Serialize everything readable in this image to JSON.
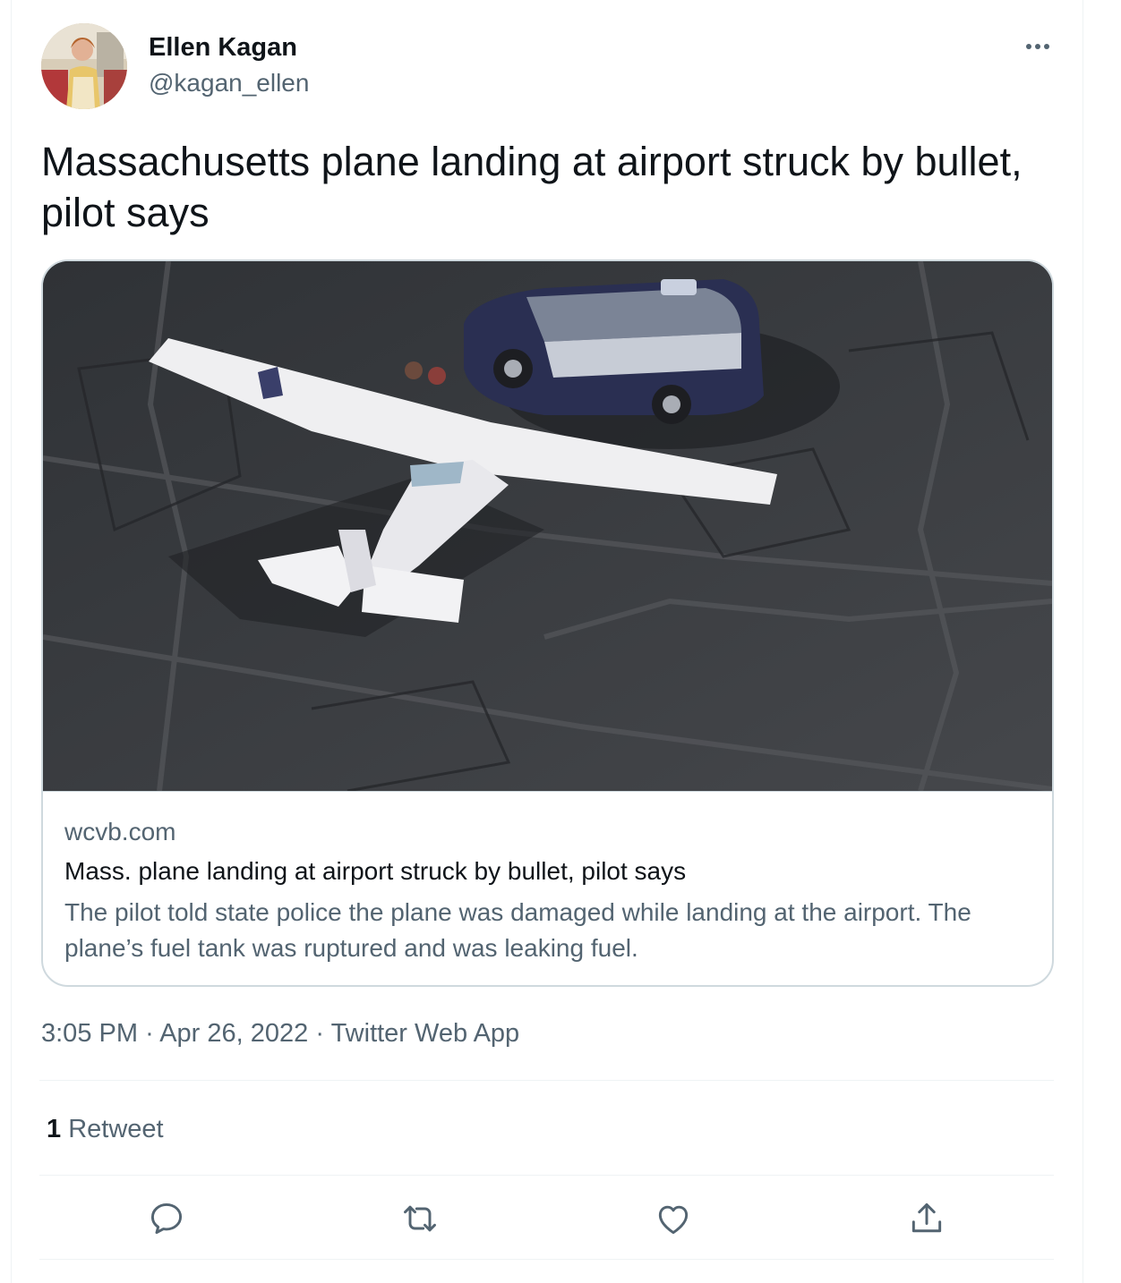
{
  "user": {
    "name": "Ellen Kagan",
    "handle": "@kagan_ellen"
  },
  "tweet": {
    "text": "Massachusetts plane landing at airport struck by bullet, pilot says"
  },
  "card": {
    "domain": "wcvb.com",
    "title": "Mass. plane landing at airport struck by bullet, pilot says",
    "description": "The pilot told state police the plane was damaged while landing at the airport. The plane’s fuel tank was ruptured and was leaking fuel."
  },
  "meta": {
    "time": "3:05 PM",
    "separator": "·",
    "date": "Apr 26, 2022",
    "source": "Twitter Web App"
  },
  "stats": {
    "retweet_count": "1",
    "retweet_label": "Retweet"
  },
  "actions": [
    {
      "icon": "reply-icon"
    },
    {
      "icon": "retweet-icon"
    },
    {
      "icon": "like-icon"
    },
    {
      "icon": "share-icon"
    }
  ],
  "colors": {
    "text_primary": "#0f1419",
    "text_secondary": "#536471",
    "border": "#cfd9de",
    "divider": "#eff3f4"
  }
}
